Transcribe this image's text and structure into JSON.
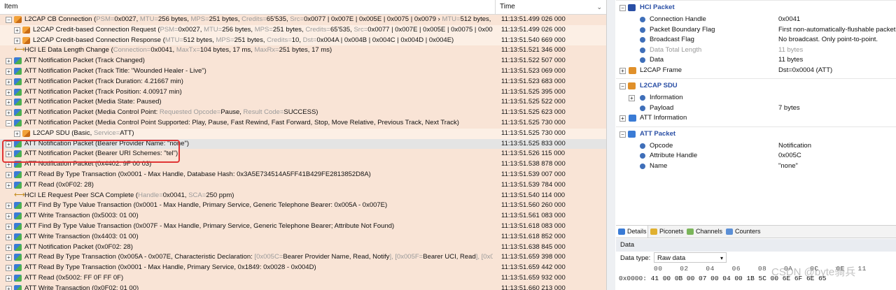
{
  "packet_list": {
    "columns": {
      "item": "Item",
      "time": "Time"
    },
    "rows": [
      {
        "indent": 0,
        "expand": "−",
        "icon": "l2cap-icon",
        "style": "s1",
        "parts": [
          {
            "t": "L2CAP CB Connection ("
          },
          {
            "t": "PSM=",
            "g": 1
          },
          {
            "t": "0x0027, "
          },
          {
            "t": "MTU=",
            "g": 1
          },
          {
            "t": "256 bytes, "
          },
          {
            "t": "MPS=",
            "g": 1
          },
          {
            "t": "251 bytes, "
          },
          {
            "t": "Credits=",
            "g": 1
          },
          {
            "t": "65'535, "
          },
          {
            "t": "Src=",
            "g": 1
          },
          {
            "t": "0x0077 | 0x007E | 0x005E | 0x0075 | 0x0079 › "
          },
          {
            "t": "MTU=",
            "g": 1
          },
          {
            "t": "512 bytes, "
          },
          {
            "t": "MPS=",
            "g": 1
          },
          {
            "t": "514..."
          }
        ],
        "time": "11:13:51.499 026 000"
      },
      {
        "indent": 1,
        "expand": "+",
        "icon": "l2cap-icon",
        "style": "s2",
        "parts": [
          {
            "t": "L2CAP Credit-based Connection Request ("
          },
          {
            "t": "PSM=",
            "g": 1
          },
          {
            "t": "0x0027, "
          },
          {
            "t": "MTU=",
            "g": 1
          },
          {
            "t": "256 bytes, "
          },
          {
            "t": "MPS=",
            "g": 1
          },
          {
            "t": "251 bytes, "
          },
          {
            "t": "Credits=",
            "g": 1
          },
          {
            "t": "65'535, "
          },
          {
            "t": "Src=",
            "g": 1
          },
          {
            "t": "0x0077 | 0x007E | 0x005E | 0x0075 | 0x0079, ACL-U..."
          }
        ],
        "time": "11:13:51.499 026 000"
      },
      {
        "indent": 1,
        "expand": "+",
        "icon": "l2cap-icon",
        "style": "s2",
        "parts": [
          {
            "t": "L2CAP Credit-based Connection Response ("
          },
          {
            "t": "MTU=",
            "g": 1
          },
          {
            "t": "512 bytes, "
          },
          {
            "t": "MPS=",
            "g": 1
          },
          {
            "t": "251 bytes, "
          },
          {
            "t": "Credits=",
            "g": 1
          },
          {
            "t": "10, "
          },
          {
            "t": "Dst=",
            "g": 1
          },
          {
            "t": "0x004A | 0x004B | 0x004C | 0x004D | 0x004E)"
          }
        ],
        "time": "11:13:51.540 669 000"
      },
      {
        "indent": 0,
        "expand": "",
        "icon": "hci-icon",
        "style": "s1",
        "parts": [
          {
            "t": "HCI LE Data Length Change ("
          },
          {
            "t": "Connection=",
            "g": 1
          },
          {
            "t": "0x0041, "
          },
          {
            "t": "MaxTx=",
            "g": 1
          },
          {
            "t": "104 bytes, 17 ms, "
          },
          {
            "t": "MaxRx=",
            "g": 1
          },
          {
            "t": "251 bytes, 17 ms)"
          }
        ],
        "time": "11:13:51.521 346 000"
      },
      {
        "indent": 0,
        "expand": "+",
        "icon": "att-icon",
        "style": "s1",
        "parts": [
          {
            "t": "ATT Notification Packet (Track Changed)"
          }
        ],
        "time": "11:13:51.522 507 000"
      },
      {
        "indent": 0,
        "expand": "+",
        "icon": "att-icon",
        "style": "s1",
        "parts": [
          {
            "t": "ATT Notification Packet (Track Title: \"Wounded Healer - Live\")"
          }
        ],
        "time": "11:13:51.523 069 000"
      },
      {
        "indent": 0,
        "expand": "+",
        "icon": "att-icon",
        "style": "s1",
        "parts": [
          {
            "t": "ATT Notification Packet (Track Duration: 4.21667 min)"
          }
        ],
        "time": "11:13:51.523 683 000"
      },
      {
        "indent": 0,
        "expand": "+",
        "icon": "att-icon",
        "style": "s1",
        "parts": [
          {
            "t": "ATT Notification Packet (Track Position: 4.00917 min)"
          }
        ],
        "time": "11:13:51.525 395 000"
      },
      {
        "indent": 0,
        "expand": "+",
        "icon": "att-icon",
        "style": "s1",
        "parts": [
          {
            "t": "ATT Notification Packet (Media State: Paused)"
          }
        ],
        "time": "11:13:51.525 522 000"
      },
      {
        "indent": 0,
        "expand": "+",
        "icon": "att-icon",
        "style": "s1",
        "parts": [
          {
            "t": "ATT Notification Packet (Media Control Point: "
          },
          {
            "t": "Requested Opcode=",
            "g": 1
          },
          {
            "t": "Pause, "
          },
          {
            "t": "Result Code=",
            "g": 1
          },
          {
            "t": "SUCCESS)"
          }
        ],
        "time": "11:13:51.525 623 000"
      },
      {
        "indent": 0,
        "expand": "−",
        "icon": "att-icon",
        "style": "s1",
        "parts": [
          {
            "t": "ATT Notification Packet (Media Control Point Supported: Play, Pause, Fast Rewind, Fast Forward, Stop, Move Relative, Previous Track, Next Track)"
          }
        ],
        "time": "11:13:51.525 730 000"
      },
      {
        "indent": 1,
        "expand": "+",
        "icon": "l2cap-icon",
        "style": "s2",
        "parts": [
          {
            "t": "L2CAP SDU (Basic, "
          },
          {
            "t": "Service=",
            "g": 1
          },
          {
            "t": "ATT)"
          }
        ],
        "time": "11:13:51.525 730 000"
      },
      {
        "indent": 0,
        "expand": "+",
        "icon": "att-icon",
        "style": "sel",
        "parts": [
          {
            "t": "ATT Notification Packet (Bearer Provider Name: \"none\")"
          }
        ],
        "time": "11:13:51.525 833 000"
      },
      {
        "indent": 0,
        "expand": "+",
        "icon": "att-icon",
        "style": "s1",
        "parts": [
          {
            "t": "ATT Notification Packet (Bearer URI Schemes: \"tel\")"
          }
        ],
        "time": "11:13:51.526 115 000"
      },
      {
        "indent": 0,
        "expand": "+",
        "icon": "att-icon",
        "style": "s1",
        "parts": [
          {
            "t": "ATT Notification Packet (0x4402: 9F 00 03)"
          }
        ],
        "time": "11:13:51.538 878 000"
      },
      {
        "indent": 0,
        "expand": "+",
        "icon": "att-icon",
        "style": "s1",
        "parts": [
          {
            "t": "ATT Read By Type Transaction (0x0001 - Max Handle, Database Hash: 0x3A5E734514A5FF41B429FE2813852D8A)"
          }
        ],
        "time": "11:13:51.539 007 000"
      },
      {
        "indent": 0,
        "expand": "+",
        "icon": "att-icon",
        "style": "s1",
        "parts": [
          {
            "t": "ATT Read (0x0F02: 28)"
          }
        ],
        "time": "11:13:51.539 784 000"
      },
      {
        "indent": 0,
        "expand": "",
        "icon": "hci-icon",
        "style": "s1",
        "parts": [
          {
            "t": "HCI LE Request Peer SCA Complete ("
          },
          {
            "t": "Handle=",
            "g": 1
          },
          {
            "t": "0x0041, "
          },
          {
            "t": "SCA=",
            "g": 1
          },
          {
            "t": "250 ppm)"
          }
        ],
        "time": "11:13:51.540 114 000"
      },
      {
        "indent": 0,
        "expand": "+",
        "icon": "att-icon",
        "style": "s1",
        "parts": [
          {
            "t": "ATT Find By Type Value Transaction (0x0001 - Max Handle, Primary Service, Generic Telephone Bearer: 0x005A - 0x007E)"
          }
        ],
        "time": "11:13:51.560 260 000"
      },
      {
        "indent": 0,
        "expand": "+",
        "icon": "att-icon",
        "style": "s1",
        "parts": [
          {
            "t": "ATT Write Transaction (0x5003: 01 00)"
          }
        ],
        "time": "11:13:51.561 083 000"
      },
      {
        "indent": 0,
        "expand": "+",
        "icon": "att-icon",
        "style": "s1",
        "parts": [
          {
            "t": "ATT Find By Type Value Transaction (0x007F - Max Handle, Primary Service, Generic Telephone Bearer; Attribute Not Found)"
          }
        ],
        "time": "11:13:51.618 083 000"
      },
      {
        "indent": 0,
        "expand": "+",
        "icon": "att-icon",
        "style": "s1",
        "parts": [
          {
            "t": "ATT Write Transaction (0x4403: 01 00)"
          }
        ],
        "time": "11:13:51.618 852 000"
      },
      {
        "indent": 0,
        "expand": "+",
        "icon": "att-icon",
        "style": "s1",
        "parts": [
          {
            "t": "ATT Notification Packet (0x0F02: 28)"
          }
        ],
        "time": "11:13:51.638 845 000"
      },
      {
        "indent": 0,
        "expand": "+",
        "icon": "att-icon",
        "style": "s1",
        "parts": [
          {
            "t": "ATT Read By Type Transaction (0x005A - 0x007E, Characteristic Declaration: "
          },
          {
            "t": "[0x005C=",
            "g": 1
          },
          {
            "t": "Bearer Provider Name, Read, Notify"
          },
          {
            "t": "], [0x005F=",
            "g": 1
          },
          {
            "t": "Bearer UCI, Read"
          },
          {
            "t": "], [0x0061=",
            "g": 1
          },
          {
            "t": "Bearer ..."
          }
        ],
        "time": "11:13:51.659 398 000"
      },
      {
        "indent": 0,
        "expand": "+",
        "icon": "att-icon",
        "style": "s1",
        "parts": [
          {
            "t": "ATT Read By Type Transaction (0x0001 - Max Handle, Primary Service, 0x1849: 0x0028 - 0x004D)"
          }
        ],
        "time": "11:13:51.659 442 000"
      },
      {
        "indent": 0,
        "expand": "+",
        "icon": "att-icon",
        "style": "s1",
        "parts": [
          {
            "t": "ATT Read (0x5002: FF 0F FF 0F)"
          }
        ],
        "time": "11:13:51.659 932 000"
      },
      {
        "indent": 0,
        "expand": "+",
        "icon": "att-icon",
        "style": "s1",
        "parts": [
          {
            "t": "ATT Write Transaction (0x0F02: 01 00)"
          }
        ],
        "time": "11:13:51.660 213 000"
      }
    ]
  },
  "details": {
    "sections": [
      {
        "title": "HCI Packet",
        "icon": "hci-packet-icon",
        "color": "#2a4fa5",
        "fields": [
          {
            "name": "Connection Handle",
            "value": "0x0041"
          },
          {
            "name": "Packet Boundary Flag",
            "value": "First non-automatically-flushable packet"
          },
          {
            "name": "Broadcast Flag",
            "value": "No broadcast. Only point-to-point."
          },
          {
            "name": "Data Total Length",
            "value": "11 bytes",
            "dim": true
          },
          {
            "name": "Data",
            "value": "11 bytes"
          }
        ],
        "tail": {
          "name": "L2CAP Frame",
          "value": "Dst=0x0004 (ATT)",
          "icon": "l2cap-icon"
        }
      },
      {
        "title": "L2CAP SDU",
        "icon": "l2cap-sdu-icon",
        "color": "#2a4fa5",
        "fields": [
          {
            "name": "Information",
            "value": "",
            "expand": "+"
          },
          {
            "name": "Payload",
            "value": "7 bytes"
          }
        ],
        "tail": {
          "name": "ATT Information",
          "value": "",
          "icon": "info-icon"
        }
      },
      {
        "title": "ATT Packet",
        "icon": "att-packet-icon",
        "color": "#2a4fa5",
        "fields": [
          {
            "name": "Opcode",
            "value": "Notification"
          },
          {
            "name": "Attribute Handle",
            "value": "0x005C"
          },
          {
            "name": "Name",
            "value": "\"none\""
          }
        ]
      }
    ],
    "tabs": [
      "Details",
      "Piconets",
      "Channels",
      "Counters"
    ],
    "data_panel": {
      "title": "Data",
      "type_label": "Data type:",
      "type_value": "Raw data",
      "hex_header": "00    02    04    06    08    0A    0C    0E   11",
      "hex_offset": "0x0000:",
      "hex_bytes": "41 00 0B 00 07 00 04 00 1B 5C 00 6E 6F 6E 65"
    },
    "watermark": "CSDN @byte骑兵"
  },
  "colors": {
    "row_tint": "#f9e4d6",
    "selected": "#e4e4e4",
    "highlight_box": "#e03535",
    "section_title": "#2a4fa5"
  }
}
